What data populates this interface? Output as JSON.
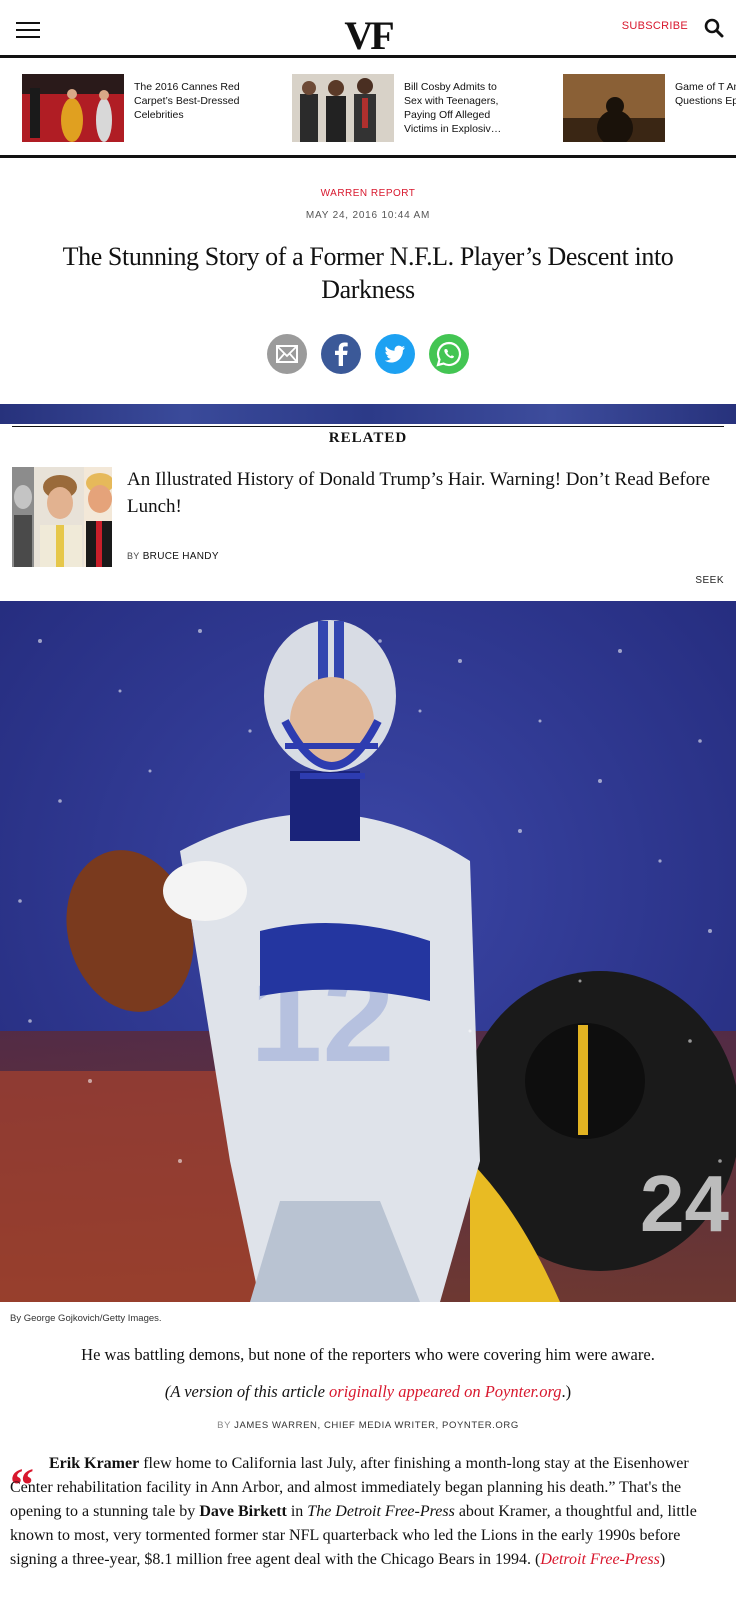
{
  "header": {
    "logo": "VF",
    "subscribe_label": "SUBSCRIBE"
  },
  "promos": [
    {
      "text": "The 2016 Cannes Red Carpet’s Best-Dressed Celebrities"
    },
    {
      "text": "Bill Cosby Admits to Sex with Teenagers, Paying Off Alleged Victims in Explosiv…"
    },
    {
      "text": "Game of T Answering Questions Episode"
    }
  ],
  "article": {
    "kicker": "WARREN REPORT",
    "date": "MAY 24, 2016 10:44 AM",
    "headline": "The Stunning Story of a Former N.F.L. Player’s Descent into Darkness",
    "caption": "By George Gojkovich/Getty Images.",
    "dek": "He was battling demons, but none of the reporters who were covering him were aware.",
    "version_prefix": "(A version of this article ",
    "version_link": "originally appeared on Poynter.org",
    "version_suffix": ".)",
    "byline_prefix": "BY",
    "byline_author": "JAMES WARREN, CHIEF MEDIA WRITER, POYNTER.ORG",
    "quote_mark": "“",
    "body_bold_1": "Erik Kramer",
    "body_1": " flew home to California last July, after finishing a month-long stay at the Eisenhower Center rehabilitation facility in Ann Arbor, and almost immediately began planning his death.” That's the opening to a stunning tale by ",
    "body_bold_2": "Dave Birkett",
    "body_2": " in ",
    "body_italic_1": "The Detroit Free-Press",
    "body_3": " about Kramer, a thoughtful and, little known to most, very tormented former star NFL quarterback who led the Lions in the early 1990s before signing a three-year, $8.1 million free agent deal with the Chicago Bears in 1994. (",
    "body_link": "Detroit Free-Press",
    "body_4": ")"
  },
  "related": {
    "label": "RELATED",
    "title": "An Illustrated History of Donald Trump’s Hair. Warning! Don’t Read Before Lunch!",
    "by_prefix": "BY",
    "author": "BRUCE HANDY",
    "seek": "SEEK"
  },
  "colors": {
    "accent": "#d8172d",
    "facebook": "#3b5998",
    "twitter": "#1da1f2",
    "whatsapp": "#43c553",
    "email": "#9b9b9b"
  },
  "icons": [
    "menu-icon",
    "search-icon",
    "email-icon",
    "facebook-icon",
    "twitter-icon",
    "whatsapp-icon"
  ]
}
